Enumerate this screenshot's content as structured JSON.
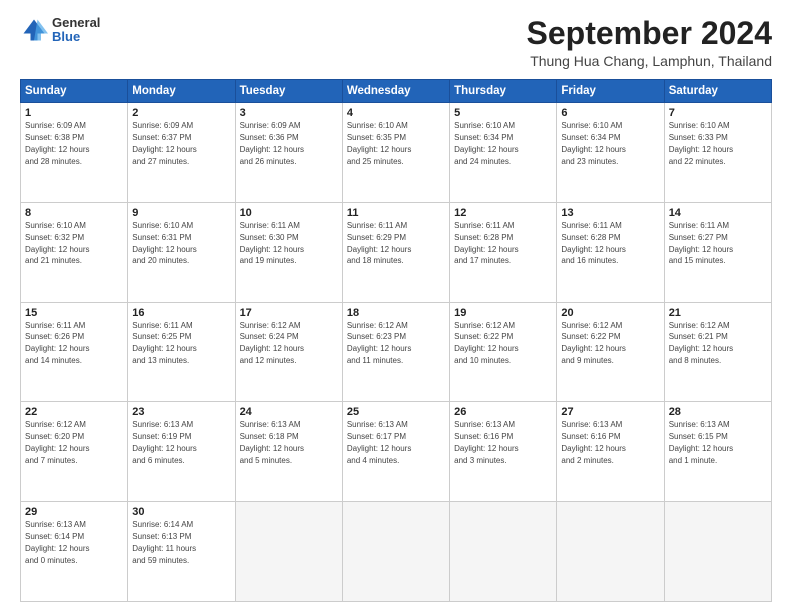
{
  "logo": {
    "general": "General",
    "blue": "Blue"
  },
  "title": "September 2024",
  "location": "Thung Hua Chang, Lamphun, Thailand",
  "days_of_week": [
    "Sunday",
    "Monday",
    "Tuesday",
    "Wednesday",
    "Thursday",
    "Friday",
    "Saturday"
  ],
  "weeks": [
    [
      {
        "day": "1",
        "sunrise": "6:09 AM",
        "sunset": "6:38 PM",
        "daylight": "12 hours and 28 minutes."
      },
      {
        "day": "2",
        "sunrise": "6:09 AM",
        "sunset": "6:37 PM",
        "daylight": "12 hours and 27 minutes."
      },
      {
        "day": "3",
        "sunrise": "6:09 AM",
        "sunset": "6:36 PM",
        "daylight": "12 hours and 26 minutes."
      },
      {
        "day": "4",
        "sunrise": "6:10 AM",
        "sunset": "6:35 PM",
        "daylight": "12 hours and 25 minutes."
      },
      {
        "day": "5",
        "sunrise": "6:10 AM",
        "sunset": "6:34 PM",
        "daylight": "12 hours and 24 minutes."
      },
      {
        "day": "6",
        "sunrise": "6:10 AM",
        "sunset": "6:34 PM",
        "daylight": "12 hours and 23 minutes."
      },
      {
        "day": "7",
        "sunrise": "6:10 AM",
        "sunset": "6:33 PM",
        "daylight": "12 hours and 22 minutes."
      }
    ],
    [
      {
        "day": "8",
        "sunrise": "6:10 AM",
        "sunset": "6:32 PM",
        "daylight": "12 hours and 21 minutes."
      },
      {
        "day": "9",
        "sunrise": "6:10 AM",
        "sunset": "6:31 PM",
        "daylight": "12 hours and 20 minutes."
      },
      {
        "day": "10",
        "sunrise": "6:11 AM",
        "sunset": "6:30 PM",
        "daylight": "12 hours and 19 minutes."
      },
      {
        "day": "11",
        "sunrise": "6:11 AM",
        "sunset": "6:29 PM",
        "daylight": "12 hours and 18 minutes."
      },
      {
        "day": "12",
        "sunrise": "6:11 AM",
        "sunset": "6:28 PM",
        "daylight": "12 hours and 17 minutes."
      },
      {
        "day": "13",
        "sunrise": "6:11 AM",
        "sunset": "6:28 PM",
        "daylight": "12 hours and 16 minutes."
      },
      {
        "day": "14",
        "sunrise": "6:11 AM",
        "sunset": "6:27 PM",
        "daylight": "12 hours and 15 minutes."
      }
    ],
    [
      {
        "day": "15",
        "sunrise": "6:11 AM",
        "sunset": "6:26 PM",
        "daylight": "12 hours and 14 minutes."
      },
      {
        "day": "16",
        "sunrise": "6:11 AM",
        "sunset": "6:25 PM",
        "daylight": "12 hours and 13 minutes."
      },
      {
        "day": "17",
        "sunrise": "6:12 AM",
        "sunset": "6:24 PM",
        "daylight": "12 hours and 12 minutes."
      },
      {
        "day": "18",
        "sunrise": "6:12 AM",
        "sunset": "6:23 PM",
        "daylight": "12 hours and 11 minutes."
      },
      {
        "day": "19",
        "sunrise": "6:12 AM",
        "sunset": "6:22 PM",
        "daylight": "12 hours and 10 minutes."
      },
      {
        "day": "20",
        "sunrise": "6:12 AM",
        "sunset": "6:22 PM",
        "daylight": "12 hours and 9 minutes."
      },
      {
        "day": "21",
        "sunrise": "6:12 AM",
        "sunset": "6:21 PM",
        "daylight": "12 hours and 8 minutes."
      }
    ],
    [
      {
        "day": "22",
        "sunrise": "6:12 AM",
        "sunset": "6:20 PM",
        "daylight": "12 hours and 7 minutes."
      },
      {
        "day": "23",
        "sunrise": "6:13 AM",
        "sunset": "6:19 PM",
        "daylight": "12 hours and 6 minutes."
      },
      {
        "day": "24",
        "sunrise": "6:13 AM",
        "sunset": "6:18 PM",
        "daylight": "12 hours and 5 minutes."
      },
      {
        "day": "25",
        "sunrise": "6:13 AM",
        "sunset": "6:17 PM",
        "daylight": "12 hours and 4 minutes."
      },
      {
        "day": "26",
        "sunrise": "6:13 AM",
        "sunset": "6:16 PM",
        "daylight": "12 hours and 3 minutes."
      },
      {
        "day": "27",
        "sunrise": "6:13 AM",
        "sunset": "6:16 PM",
        "daylight": "12 hours and 2 minutes."
      },
      {
        "day": "28",
        "sunrise": "6:13 AM",
        "sunset": "6:15 PM",
        "daylight": "12 hours and 1 minute."
      }
    ],
    [
      {
        "day": "29",
        "sunrise": "6:13 AM",
        "sunset": "6:14 PM",
        "daylight": "12 hours and 0 minutes."
      },
      {
        "day": "30",
        "sunrise": "6:14 AM",
        "sunset": "6:13 PM",
        "daylight": "11 hours and 59 minutes."
      },
      null,
      null,
      null,
      null,
      null
    ]
  ]
}
